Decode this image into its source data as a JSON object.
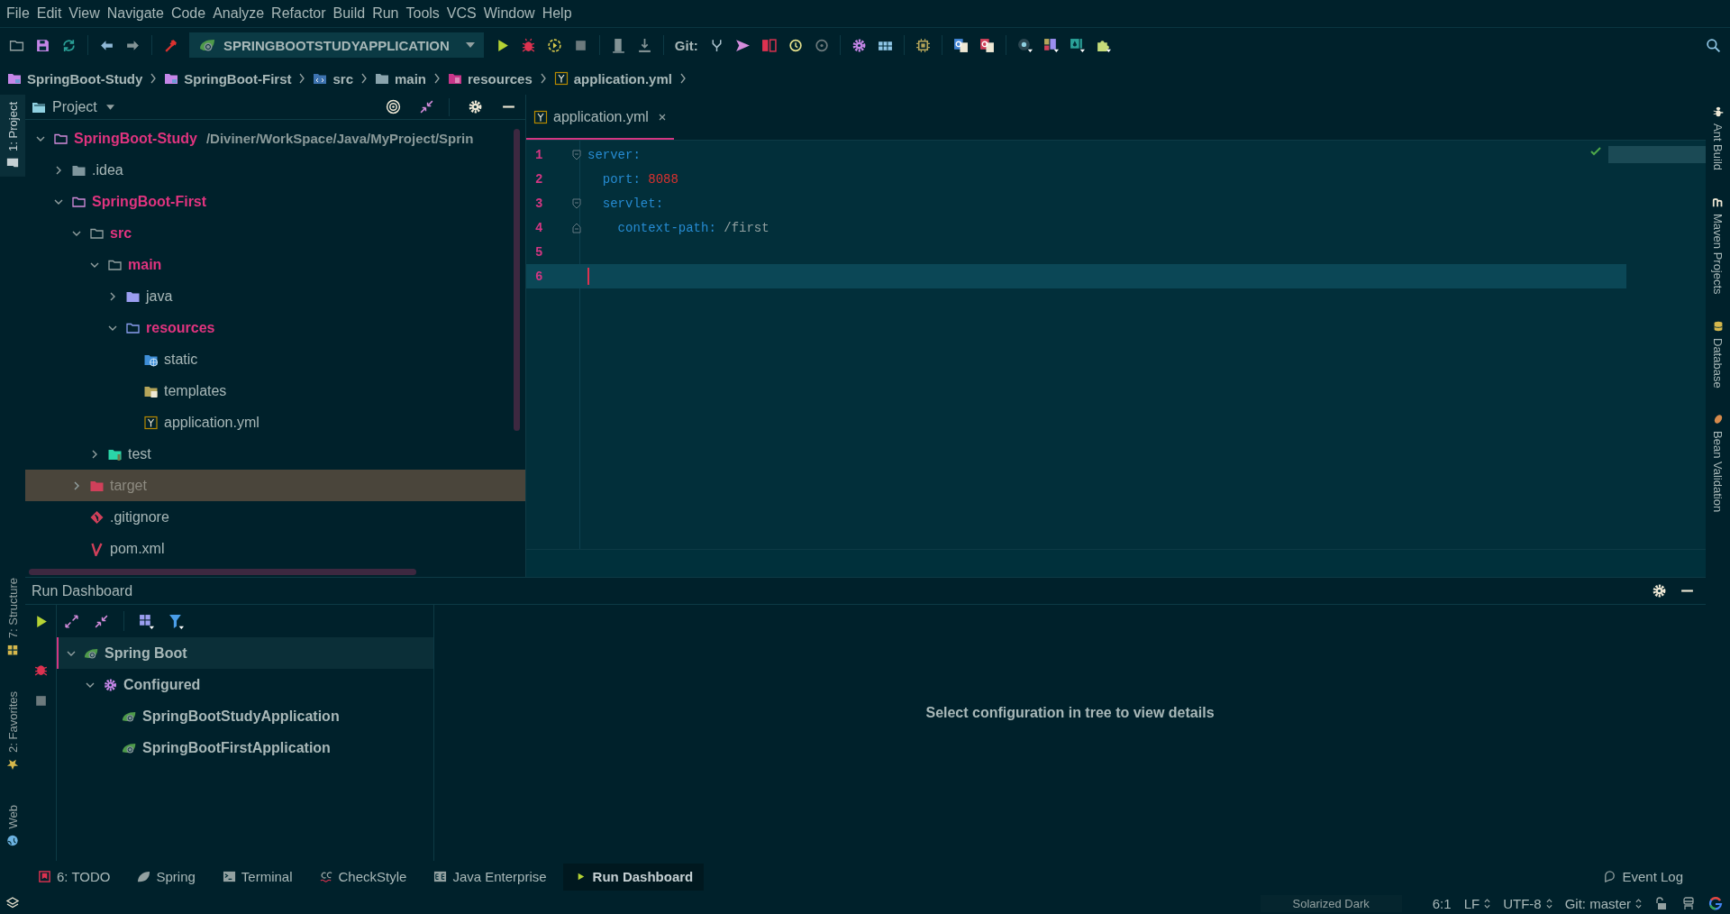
{
  "menu": [
    "File",
    "Edit",
    "View",
    "Navigate",
    "Code",
    "Analyze",
    "Refactor",
    "Build",
    "Run",
    "Tools",
    "VCS",
    "Window",
    "Help"
  ],
  "toolbar": {
    "run_config": "SPRINGBOOTSTUDYAPPLICATION",
    "git_label": "Git:"
  },
  "breadcrumbs": [
    {
      "label": "SpringBoot-Study",
      "kind": "module"
    },
    {
      "label": "SpringBoot-First",
      "kind": "module"
    },
    {
      "label": "src",
      "kind": "source"
    },
    {
      "label": "main",
      "kind": "folder"
    },
    {
      "label": "resources",
      "kind": "resources"
    },
    {
      "label": "application.yml",
      "kind": "yaml"
    }
  ],
  "left_top_tools": [
    {
      "label": "1: Project",
      "kind": "project",
      "selected": true
    }
  ],
  "left_bottom_tools": [
    {
      "label": "7: Structure",
      "kind": "structure",
      "selected": false
    },
    {
      "label": "2: Favorites",
      "kind": "favorites",
      "selected": false
    },
    {
      "label": "Web",
      "kind": "web",
      "selected": false
    }
  ],
  "project": {
    "title": "Project",
    "tree": [
      {
        "label": "SpringBoot-Study",
        "path": "/Diviner/WorkSpace/Java/MyProject/Sprin",
        "kind": "module",
        "modified": true,
        "selected": false,
        "expanded": true,
        "children": [
          {
            "label": ".idea",
            "kind": "plain",
            "modified": false,
            "selected": false,
            "expanded": false
          },
          {
            "label": "SpringBoot-First",
            "kind": "module",
            "modified": true,
            "selected": false,
            "expanded": true,
            "children": [
              {
                "label": "src",
                "kind": "outline",
                "modified": true,
                "selected": false,
                "expanded": true,
                "children": [
                  {
                    "label": "main",
                    "kind": "outline",
                    "modified": true,
                    "selected": false,
                    "expanded": true,
                    "children": [
                      {
                        "label": "java",
                        "kind": "java",
                        "modified": false,
                        "selected": false,
                        "expanded": false
                      },
                      {
                        "label": "resources",
                        "kind": "outline",
                        "modified": true,
                        "selected": false,
                        "expanded": true,
                        "children": [
                          {
                            "label": "static",
                            "kind": "web",
                            "modified": false,
                            "selected": false
                          },
                          {
                            "label": "templates",
                            "kind": "templates",
                            "modified": false,
                            "selected": false
                          },
                          {
                            "label": "application.yml",
                            "kind": "yaml",
                            "modified": false,
                            "selected": false
                          }
                        ]
                      }
                    ]
                  },
                  {
                    "label": "test",
                    "kind": "test",
                    "modified": false,
                    "selected": false,
                    "expanded": false
                  }
                ]
              },
              {
                "label": "target",
                "kind": "excluded",
                "modified": false,
                "selected": true,
                "expanded": false
              },
              {
                "label": ".gitignore",
                "kind": "git",
                "modified": false,
                "selected": false
              },
              {
                "label": "pom.xml",
                "kind": "maven",
                "modified": false,
                "selected": false
              }
            ]
          }
        ]
      }
    ]
  },
  "editor": {
    "tabs": [
      {
        "label": "application.yml",
        "selected": true
      }
    ],
    "lines": [
      {
        "number": "1",
        "fold_start": true,
        "fold_end": false,
        "current": false,
        "tokens": [
          {
            "text": "server",
            "kind": "key"
          },
          {
            "text": ":",
            "kind": "colon"
          }
        ]
      },
      {
        "number": "2",
        "fold_start": false,
        "fold_end": false,
        "current": false,
        "tokens": [
          {
            "text": "  port",
            "kind": "key"
          },
          {
            "text": ": ",
            "kind": "colon"
          },
          {
            "text": "8088",
            "kind": "number"
          }
        ]
      },
      {
        "number": "3",
        "fold_start": true,
        "fold_end": false,
        "current": false,
        "tokens": [
          {
            "text": "  servlet",
            "kind": "key"
          },
          {
            "text": ":",
            "kind": "colon"
          }
        ]
      },
      {
        "number": "4",
        "fold_start": false,
        "fold_end": true,
        "current": false,
        "tokens": [
          {
            "text": "    context-path",
            "kind": "key"
          },
          {
            "text": ": ",
            "kind": "colon"
          },
          {
            "text": "/first",
            "kind": "plain"
          }
        ]
      },
      {
        "number": "5",
        "fold_start": false,
        "fold_end": false,
        "current": false
      },
      {
        "number": "6",
        "fold_start": false,
        "fold_end": false,
        "current": true
      }
    ]
  },
  "right_tools": [
    {
      "label": "Ant Build",
      "kind": "ant"
    },
    {
      "label": "Maven Projects",
      "kind": "maven"
    },
    {
      "label": "Database",
      "kind": "database"
    },
    {
      "label": "Bean Validation",
      "kind": "bean"
    }
  ],
  "run_dashboard": {
    "title": "Run Dashboard",
    "tree": [
      {
        "label": "Spring Boot",
        "kind": "spring",
        "selected": true,
        "expanded": true,
        "children": [
          {
            "label": "Configured",
            "kind": "gear",
            "selected": false,
            "expanded": true,
            "children": [
              {
                "label": "SpringBootStudyApplication",
                "kind": "app",
                "selected": false
              },
              {
                "label": "SpringBootFirstApplication",
                "kind": "app",
                "selected": false
              }
            ]
          }
        ]
      }
    ],
    "detail": "Select configuration in tree to view details"
  },
  "bottom_tabs": [
    {
      "label": "6: TODO",
      "kind": "todo",
      "selected": false
    },
    {
      "label": "Spring",
      "kind": "spring",
      "selected": false
    },
    {
      "label": "Terminal",
      "kind": "terminal",
      "selected": false
    },
    {
      "label": "CheckStyle",
      "kind": "checkstyle",
      "selected": false
    },
    {
      "label": "Java Enterprise",
      "kind": "enterprise",
      "selected": false
    },
    {
      "label": "Run Dashboard",
      "kind": "run",
      "selected": true
    }
  ],
  "event_log": "Event Log",
  "status_bar": {
    "theme": "Solarized Dark",
    "position": "6:1",
    "line_separator": "LF",
    "encoding": "UTF-8",
    "vcs": "Git: master"
  }
}
